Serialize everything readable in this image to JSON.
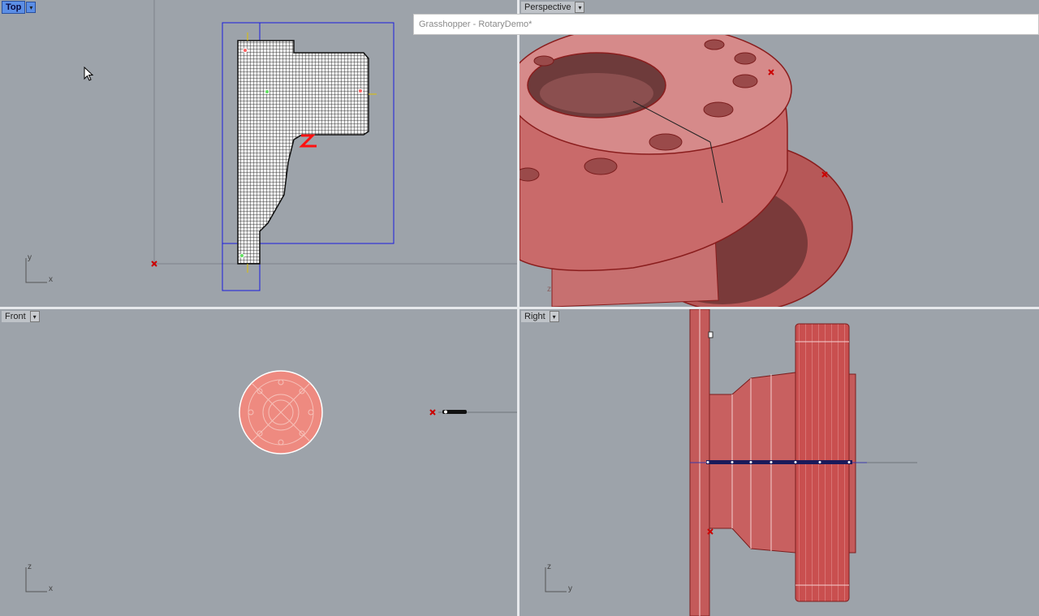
{
  "viewports": {
    "top": {
      "label": "Top",
      "axis_x": "x",
      "axis_y": "y"
    },
    "perspective": {
      "label": "Perspective",
      "axis_z": "z"
    },
    "front": {
      "label": "Front",
      "axis_x": "x",
      "axis_y": "z"
    },
    "right": {
      "label": "Right",
      "axis_x": "y",
      "axis_y": "z"
    }
  },
  "grasshopper": {
    "title": "Grasshopper - RotaryDemo*"
  },
  "icons": {
    "dropdown": "▾"
  },
  "colors": {
    "viewport_bg": "#9da3aa",
    "active_tab": "#5b8ee6",
    "selection_box": "#1a1aff",
    "model_red": "#c85050",
    "marker_red": "#cc0000"
  }
}
